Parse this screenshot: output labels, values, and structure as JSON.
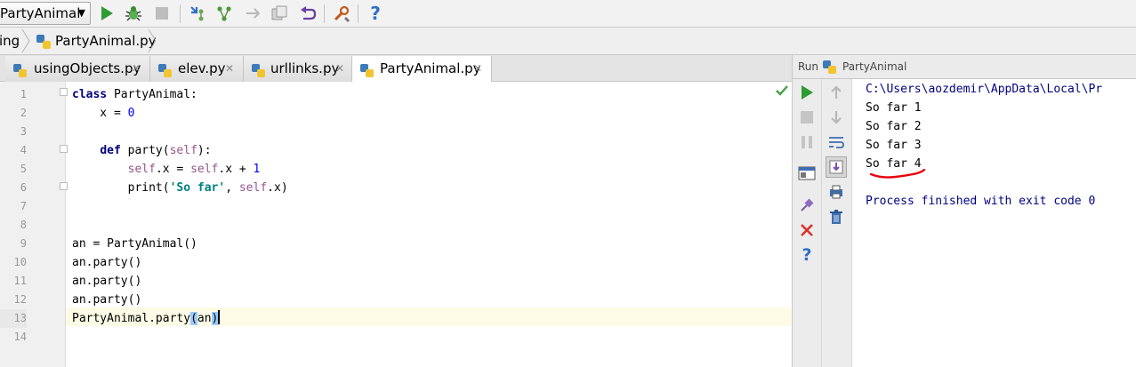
{
  "toolbar": {
    "run_config": "PartyAnimal"
  },
  "breadcrumb": {
    "parent": "ing",
    "file": "PartyAnimal.py"
  },
  "tabs": [
    {
      "label": "usingObjects.py",
      "active": false
    },
    {
      "label": "elev.py",
      "active": false
    },
    {
      "label": "urllinks.py",
      "active": false
    },
    {
      "label": "PartyAnimal.py",
      "active": true
    }
  ],
  "editor": {
    "line_numbers": [
      "1",
      "2",
      "3",
      "4",
      "5",
      "6",
      "7",
      "8",
      "9",
      "10",
      "11",
      "12",
      "13",
      "14"
    ],
    "lines": {
      "l1_kw": "class",
      "l1_rest": " PartyAnimal:",
      "l2_pre": "    x = ",
      "l2_num": "0",
      "l4_pre": "    ",
      "l4_kw": "def",
      "l4_mid": " party(",
      "l4_self": "self",
      "l4_end": "):",
      "l5_pre": "        ",
      "l5_self1": "self",
      "l5_mid": ".x = ",
      "l5_self2": "self",
      "l5_mid2": ".x + ",
      "l5_num": "1",
      "l6_pre": "        print(",
      "l6_str": "'So far'",
      "l6_mid": ", ",
      "l6_self": "self",
      "l6_end": ".x)",
      "l9": "an = PartyAnimal()",
      "l10": "an.party()",
      "l11": "an.party()",
      "l12": "an.party()",
      "l13_pre": "PartyAnimal.party",
      "l13_open": "(",
      "l13_arg": "an",
      "l13_close": ")"
    }
  },
  "run_panel": {
    "label": "Run",
    "config": "PartyAnimal",
    "output": [
      "C:\\Users\\aozdemir\\AppData\\Local\\Pr",
      "So far 1",
      "So far 2",
      "So far 3",
      "So far 4",
      "",
      "Process finished with exit code 0"
    ],
    "highlight_color": "#e8000d"
  },
  "colors": {
    "run_green": "#3a9b2f",
    "debug_green": "#4caf50",
    "keyword": "#000080",
    "number": "#0000ff",
    "self": "#94558d",
    "string": "#008080"
  }
}
